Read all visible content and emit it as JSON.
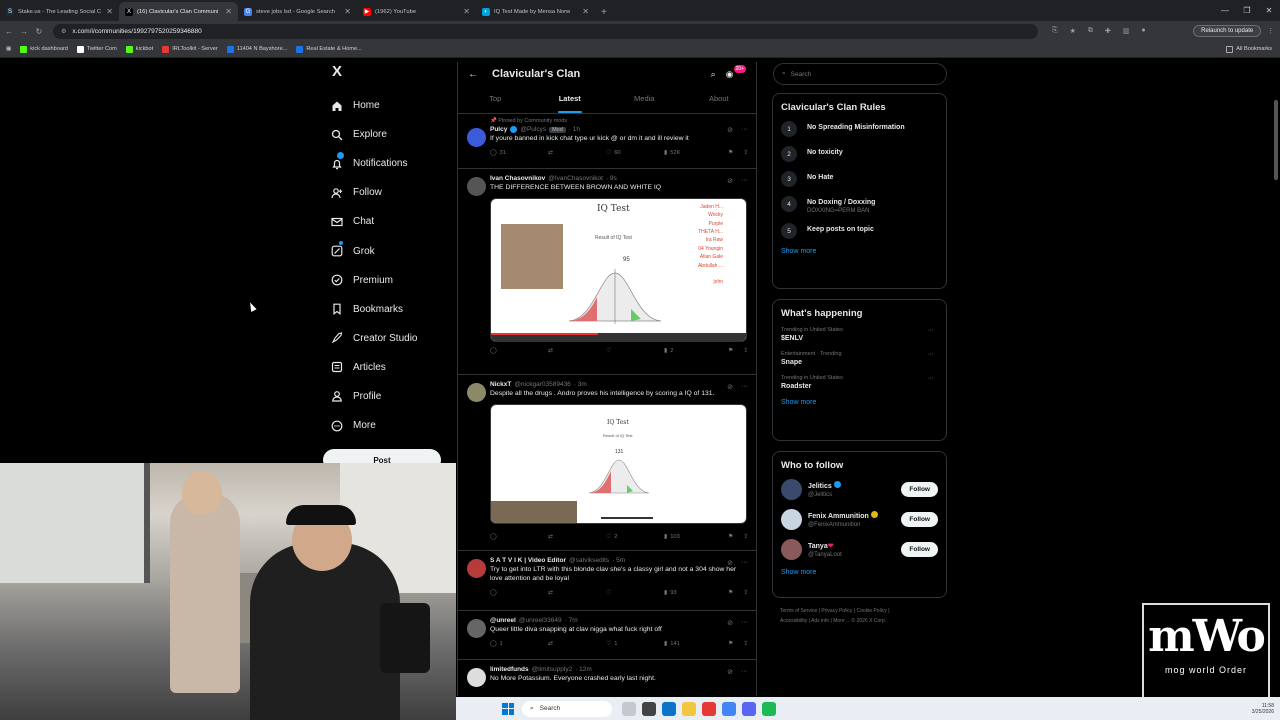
{
  "browser": {
    "tabs": [
      {
        "label": "Stake.us - The Leading Social C",
        "favicon": "S",
        "color": "#1a2c38",
        "active": false
      },
      {
        "label": "(16) Clavicular's Clan Communi",
        "favicon": "X",
        "color": "#000000",
        "active": true
      },
      {
        "label": "steve jobs lsd - Google Search",
        "favicon": "G",
        "color": "#4285f4",
        "active": false
      },
      {
        "label": "(1962) YouTube",
        "favicon": "▶",
        "color": "#ff0000",
        "active": false
      },
      {
        "label": "IQ Test Made by Mensa Norw",
        "favicon": "◐",
        "color": "#00a0e0",
        "active": false
      }
    ],
    "url": "x.com/i/communities/1992797520259346880",
    "relaunch_label": "Relaunch to update",
    "bookmarks": [
      {
        "label": "kick dashboard",
        "color": "#53fc18"
      },
      {
        "label": "Twitter Com",
        "color": "#000000"
      },
      {
        "label": "kickbot",
        "color": "#53fc18"
      },
      {
        "label": "IRLToolkit - Server",
        "color": "#e53935"
      },
      {
        "label": "11404 N Bayshore...",
        "color": "#1a73e8"
      },
      {
        "label": "Real Estate & Home...",
        "color": "#1a73e8"
      }
    ],
    "all_bookmarks": "All Bookmarks"
  },
  "sidebar": {
    "logo": "X",
    "items": [
      {
        "label": "Home",
        "icon": "home-icon"
      },
      {
        "label": "Explore",
        "icon": "search-icon"
      },
      {
        "label": "Notifications",
        "icon": "bell-icon"
      },
      {
        "label": "Follow",
        "icon": "person-add-icon"
      },
      {
        "label": "Chat",
        "icon": "mail-icon"
      },
      {
        "label": "Grok",
        "icon": "grok-icon"
      },
      {
        "label": "Premium",
        "icon": "x-premium-icon"
      },
      {
        "label": "Bookmarks",
        "icon": "bookmark-icon"
      },
      {
        "label": "Creator Studio",
        "icon": "rocket-icon"
      },
      {
        "label": "Articles",
        "icon": "article-icon"
      },
      {
        "label": "Profile",
        "icon": "person-icon"
      },
      {
        "label": "More",
        "icon": "more-circle-icon"
      }
    ],
    "post_label": "Post"
  },
  "community": {
    "title": "Clavicular's Clan",
    "badge": "20+",
    "tabs": [
      "Top",
      "Latest",
      "Media",
      "About"
    ],
    "active_tab": "Latest"
  },
  "posts": [
    {
      "pinned": "Pinned by Community mods",
      "name": "Pulcy",
      "handle": "@Pulcys",
      "badge": "Mod",
      "time": "· 1h",
      "text": "If youre banned in kick chat type ur kick @ or dm it and ill review it",
      "replies": "31",
      "reposts": "",
      "likes": "60",
      "views": "52K"
    },
    {
      "name": "Ivan Chasovnikov",
      "handle": "@IvanChasovnikot",
      "time": "· 9s",
      "text": "THE DIFFERENCE BETWEEN BROWN AND WHITE IQ",
      "replies": "",
      "reposts": "",
      "likes": "",
      "views": "2",
      "media": {
        "title": "IQ Test",
        "result": "Result of IQ Test",
        "score": "95",
        "names": [
          "Jaden H...",
          "Wocky",
          "Purple",
          "THETA H...",
          "Ira Raw",
          "04 Youngin",
          "Allan Gale",
          "Abdullah ...",
          "john"
        ]
      }
    },
    {
      "name": "NickxT",
      "handle": "@nickgar03589436",
      "time": "· 3m",
      "text": "Despite all the drugs . Andro proves his intelligence by scoring a IQ of 131.",
      "replies": "",
      "reposts": "",
      "likes": "2",
      "views": "103",
      "media": {
        "title": "IQ Test",
        "result": "Result of IQ Test",
        "score": "131"
      }
    },
    {
      "name": "S A T V I K | Video Editor",
      "handle": "@satviksedits",
      "time": "· 5m",
      "text": "Try to get into LTR with this blonde clav she's a classy girl and not a 304 show her love attention and be loyal",
      "replies": "",
      "reposts": "",
      "likes": "",
      "views": "93"
    },
    {
      "name": "@unreel",
      "handle": "@unreel33649",
      "time": "· 7m",
      "text": "Queer little diva snapping at clav nigga what fuck right off",
      "replies": "1",
      "reposts": "",
      "likes": "1",
      "views": "141"
    },
    {
      "name": "limitedfunds",
      "handle": "@limitsupply2",
      "time": "· 12m",
      "text": "No More Potassium. Everyone crashed early last night.",
      "replies": "",
      "reposts": "",
      "likes": "",
      "views": ""
    }
  ],
  "right": {
    "search_placeholder": "Search",
    "rules_title": "Clavicular's Clan Rules",
    "rules": [
      {
        "n": "1",
        "t": "No Spreading Misinformation",
        "s": ""
      },
      {
        "n": "2",
        "t": "No toxicity",
        "s": ""
      },
      {
        "n": "3",
        "t": "No Hate",
        "s": ""
      },
      {
        "n": "4",
        "t": "No Doxing / Doxxing",
        "s": "DOXXING=PERM BAN"
      },
      {
        "n": "5",
        "t": "Keep posts on topic",
        "s": ""
      }
    ],
    "show_more": "Show more",
    "happening_title": "What's happening",
    "trends": [
      {
        "meta": "Trending in United States",
        "name": "$ENLV"
      },
      {
        "meta": "Entertainment · Trending",
        "name": "Snape"
      },
      {
        "meta": "Trending in United States",
        "name": "Roadster"
      }
    ],
    "wtf_title": "Who to follow",
    "follow_label": "Follow",
    "wtf": [
      {
        "name": "Jelitics",
        "handle": "@Jelitics",
        "color": "#3b4a6b"
      },
      {
        "name": "Fenix Ammunition",
        "handle": "@FenixAmmunition",
        "color": "#c9d6e0"
      },
      {
        "name": "Tanya",
        "handle": "@TanyaLoot",
        "color": "#8a5a5a"
      }
    ],
    "footer": [
      "Terms of Service",
      "Privacy Policy",
      "Cookie Policy",
      "Accessibility",
      "Ads info",
      "More ...",
      "© 2026 X Corp."
    ]
  },
  "overlay": {
    "brand": "mWo",
    "brand_sub": "mog world Order"
  },
  "taskbar": {
    "search_label": "Search",
    "time": "11:58",
    "date": "3/25/2026"
  }
}
